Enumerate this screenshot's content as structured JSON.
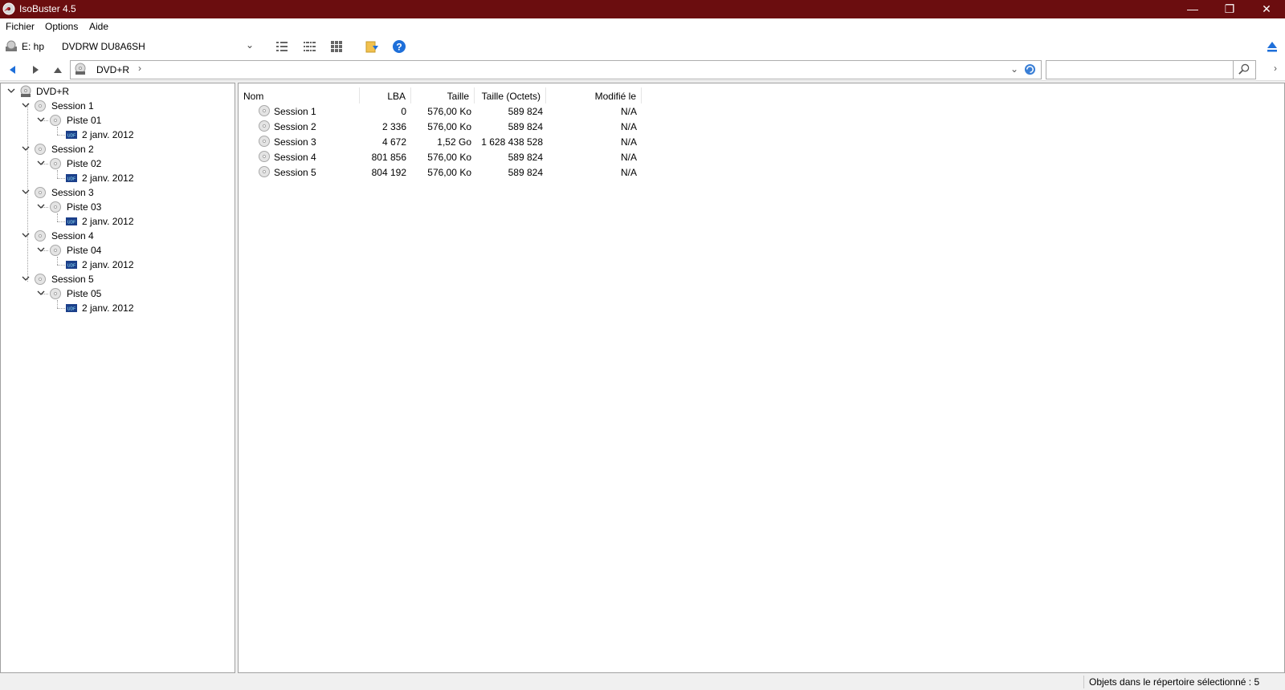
{
  "window": {
    "title": "IsoBuster 4.5"
  },
  "menu": {
    "items": [
      "Fichier",
      "Options",
      "Aide"
    ]
  },
  "toolbar": {
    "drive_letter": "E: hp",
    "drive_name": "DVDRW  DU8A6SH"
  },
  "address": {
    "crumb": "DVD+R",
    "search_placeholder": ""
  },
  "tree": {
    "root": "DVD+R",
    "sessions": [
      {
        "label": "Session 1",
        "track": "Piste 01",
        "file": "2 janv. 2012"
      },
      {
        "label": "Session 2",
        "track": "Piste 02",
        "file": "2 janv. 2012"
      },
      {
        "label": "Session 3",
        "track": "Piste 03",
        "file": "2 janv. 2012"
      },
      {
        "label": "Session 4",
        "track": "Piste 04",
        "file": "2 janv. 2012"
      },
      {
        "label": "Session 5",
        "track": "Piste 05",
        "file": "2 janv. 2012"
      }
    ]
  },
  "list": {
    "columns": [
      "Nom",
      "LBA",
      "Taille",
      "Taille (Octets)",
      "Modifié le"
    ],
    "rows": [
      {
        "name": "Session 1",
        "lba": "0",
        "size": "576,00 Ko",
        "bytes": "589 824",
        "modified": "N/A"
      },
      {
        "name": "Session 2",
        "lba": "2 336",
        "size": "576,00 Ko",
        "bytes": "589 824",
        "modified": "N/A"
      },
      {
        "name": "Session 3",
        "lba": "4 672",
        "size": "1,52 Go",
        "bytes": "1 628 438 528",
        "modified": "N/A"
      },
      {
        "name": "Session 4",
        "lba": "801 856",
        "size": "576,00 Ko",
        "bytes": "589 824",
        "modified": "N/A"
      },
      {
        "name": "Session 5",
        "lba": "804 192",
        "size": "576,00 Ko",
        "bytes": "589 824",
        "modified": "N/A"
      }
    ]
  },
  "status": {
    "text": "Objets dans le répertoire sélectionné : 5"
  },
  "colors": {
    "titlebar": "#6b0d0f",
    "accent": "#1e6fd9"
  }
}
